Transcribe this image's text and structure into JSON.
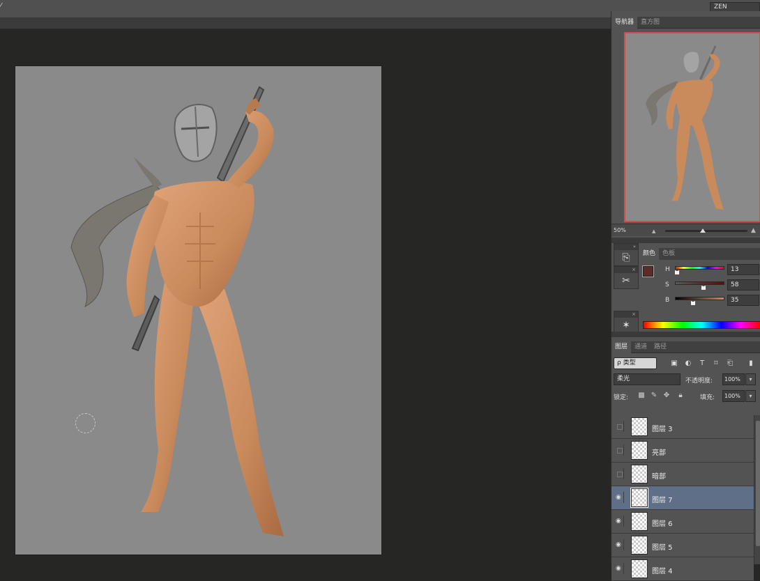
{
  "workspace": {
    "label": "ZEN"
  },
  "navigator": {
    "tabs": [
      "导航器",
      "直方图"
    ],
    "zoom": "50%",
    "zoom_slider_fraction": 0.55
  },
  "color": {
    "tabs": [
      "颜色",
      "色板"
    ],
    "foreground": "#5e2c27",
    "background": "#535353",
    "h": {
      "label": "H",
      "value": "13"
    },
    "s": {
      "label": "S",
      "value": "58"
    },
    "b": {
      "label": "B",
      "value": "35"
    }
  },
  "layers": {
    "tabs": [
      "图层",
      "通道",
      "路径"
    ],
    "filter_label": "ρ 类型",
    "blend_mode": "柔光",
    "opacity_label": "不透明度:",
    "opacity": "100%",
    "lock_label": "锁定:",
    "fill_label": "填充:",
    "fill": "100%",
    "items": [
      {
        "name": "图层 3",
        "visible": false,
        "selected": false
      },
      {
        "name": "亮部",
        "visible": false,
        "selected": false
      },
      {
        "name": "暗部",
        "visible": false,
        "selected": false
      },
      {
        "name": "图层 7",
        "visible": true,
        "selected": true
      },
      {
        "name": "图层 6",
        "visible": true,
        "selected": false
      },
      {
        "name": "图层 5",
        "visible": true,
        "selected": false
      },
      {
        "name": "图层 4",
        "visible": true,
        "selected": false
      }
    ]
  },
  "colors": {
    "canvas_bg": "#8a8a8a",
    "panel_bg": "#535353",
    "selection": "#5f6f87",
    "nav_frame": "#d44b4b",
    "skin": "#c98a5c"
  }
}
